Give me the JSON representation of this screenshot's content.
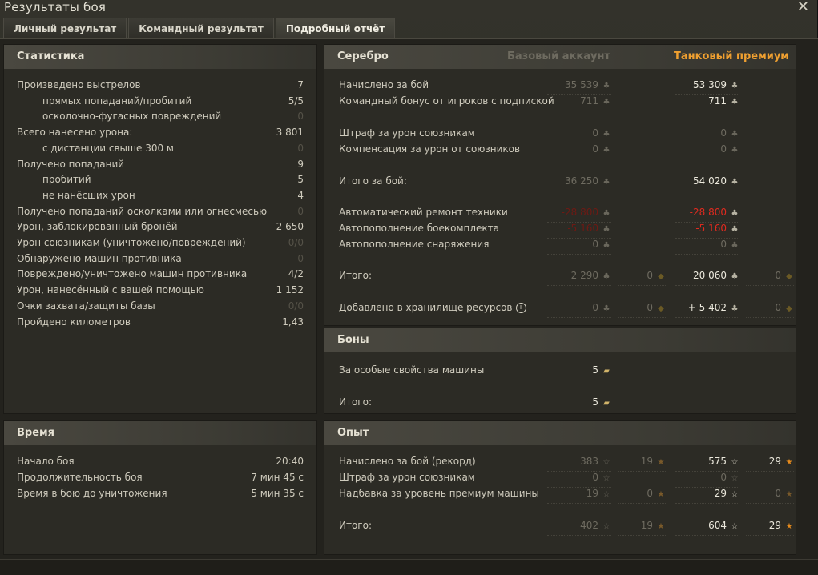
{
  "window": {
    "title": "Результаты боя",
    "close_icon": "close-icon"
  },
  "tabs": [
    {
      "label": "Личный результат"
    },
    {
      "label": "Командный результат"
    },
    {
      "label": "Подробный отчёт"
    }
  ],
  "stats": {
    "title": "Статистика",
    "rows": [
      {
        "label": "Произведено выстрелов",
        "value": "7"
      },
      {
        "label": "прямых попаданий/пробитий",
        "value": "5/5"
      },
      {
        "label": "осколочно-фугасных повреждений",
        "value": "0"
      },
      {
        "label": "Всего нанесено урона:",
        "value": "3 801"
      },
      {
        "label": "с дистанции свыше 300 м",
        "value": "0"
      },
      {
        "label": "Получено попаданий",
        "value": "9"
      },
      {
        "label": "пробитий",
        "value": "5"
      },
      {
        "label": "не нанёсших урон",
        "value": "4"
      },
      {
        "label": "Получено попаданий осколками или огнесмесью",
        "value": "0"
      },
      {
        "label": "Урон, заблокированный бронёй",
        "value": "2 650"
      },
      {
        "label": "Урон союзникам (уничтожено/повреждений)",
        "value": "0/0"
      },
      {
        "label": "Обнаружено машин противника",
        "value": "0"
      },
      {
        "label": "Повреждено/уничтожено машин противника",
        "value": "4/2"
      },
      {
        "label": "Урон, нанесённый с вашей помощью",
        "value": "1 152"
      },
      {
        "label": "Очки захвата/защиты базы",
        "value": "0/0"
      },
      {
        "label": "Пройдено километров",
        "value": "1,43"
      }
    ]
  },
  "time": {
    "title": "Время",
    "rows": [
      {
        "label": "Начало боя",
        "value": "20:40"
      },
      {
        "label": "Продолжительность боя",
        "value": "7 мин 45 с"
      },
      {
        "label": "Время в бою до уничтожения",
        "value": "5 мин 35 с"
      }
    ]
  },
  "silver": {
    "title": "Серебро",
    "col_basic": "Базовый аккаунт",
    "col_premium": "Танковый премиум",
    "rows": [
      {
        "label": "Начислено за бой",
        "basic": "35 539",
        "premium": "53 309"
      },
      {
        "label": "Командный бонус от игроков с подпиской",
        "basic": "711",
        "premium": "711"
      },
      {
        "label": "Штраф за урон союзникам",
        "basic": "0",
        "premium": "0"
      },
      {
        "label": "Компенсация за урон от союзников",
        "basic": "0",
        "premium": "0"
      },
      {
        "label": "Итого за бой:",
        "basic": "36 250",
        "premium": "54 020"
      },
      {
        "label": "Автоматический ремонт техники",
        "basic": "-28 800",
        "premium": "-28 800"
      },
      {
        "label": "Автопополнение боекомплекта",
        "basic": "-5 160",
        "premium": "-5 160"
      },
      {
        "label": "Автопополнение снаряжения",
        "basic": "0",
        "premium": "0"
      }
    ],
    "total": {
      "label": "Итого:",
      "basic": "2 290",
      "basic_gold": "0",
      "premium": "20 060",
      "premium_gold": "0"
    },
    "storage": {
      "label": "Добавлено в хранилище ресурсов",
      "basic": "0",
      "basic_gold": "0",
      "premium": "+ 5 402",
      "premium_gold": "0"
    }
  },
  "bonds": {
    "title": "Боны",
    "rows": [
      {
        "label": "За особые свойства машины",
        "value": "5"
      },
      {
        "label": "Итого:",
        "value": "5"
      }
    ]
  },
  "exp": {
    "title": "Опыт",
    "rows": [
      {
        "label": "Начислено за бой (рекорд)",
        "basic": "383",
        "basic_free": "19",
        "premium": "575",
        "premium_free": "29"
      },
      {
        "label": "Штраф за урон союзникам",
        "basic": "0",
        "basic_free": "",
        "premium": "0",
        "premium_free": ""
      },
      {
        "label": "Надбавка за уровень премиум машины",
        "basic": "19",
        "basic_free": "0",
        "premium": "29",
        "premium_free": "0"
      },
      {
        "label": "Итого:",
        "basic": "402",
        "basic_free": "19",
        "premium": "604",
        "premium_free": "29"
      }
    ]
  },
  "colors": {
    "premium_header": "#f0a030",
    "negative": "#e02a1f",
    "free_xp_star": "#e58a1c"
  }
}
